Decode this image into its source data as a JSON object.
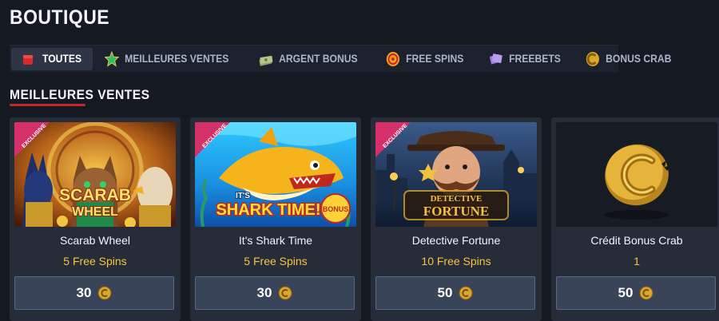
{
  "page": {
    "title": "BOUTIQUE"
  },
  "filters": [
    {
      "label": "TOUTES",
      "icon": "red-cube-icon",
      "active": true
    },
    {
      "label": "MEILLEURES VENTES",
      "icon": "green-star-icon",
      "active": false
    },
    {
      "label": "ARGENT BONUS",
      "icon": "cash-stack-icon",
      "active": false
    },
    {
      "label": "FREE SPINS",
      "icon": "spin-coin-icon",
      "active": false
    },
    {
      "label": "FREEBETS",
      "icon": "ticket-icon",
      "active": false
    },
    {
      "label": "BONUS CRAB",
      "icon": "crab-coin-icon",
      "active": false
    }
  ],
  "section": {
    "title": "MEILLEURES VENTES"
  },
  "cards": [
    {
      "name": "Scarab Wheel",
      "reward_amount": "5",
      "reward_unit": "Free Spins",
      "price": "30",
      "badge": "EXCLUSIVE",
      "art_title_1": "SCARAB",
      "art_title_2": "WHEEL"
    },
    {
      "name": "It's Shark Time",
      "reward_amount": "5",
      "reward_unit": "Free Spins",
      "price": "30",
      "badge": "EXCLUSIVE",
      "art_title_1": "IT'S",
      "art_title_2": "SHARK TIME!",
      "art_title_3": "BONUS"
    },
    {
      "name": "Detective Fortune",
      "reward_amount": "10",
      "reward_unit": "Free Spins",
      "price": "50",
      "badge": "EXCLUSIVE",
      "art_title_1": "DETECTIVE",
      "art_title_2": "FORTUNE"
    },
    {
      "name": "Crédit Bonus Crab",
      "reward_amount": "1",
      "reward_unit": "",
      "price": "50"
    }
  ],
  "colors": {
    "background": "#141922",
    "card": "#262c38",
    "accent_red": "#c8252b",
    "reward_gold": "#f5c542",
    "button": "#3a4458"
  }
}
